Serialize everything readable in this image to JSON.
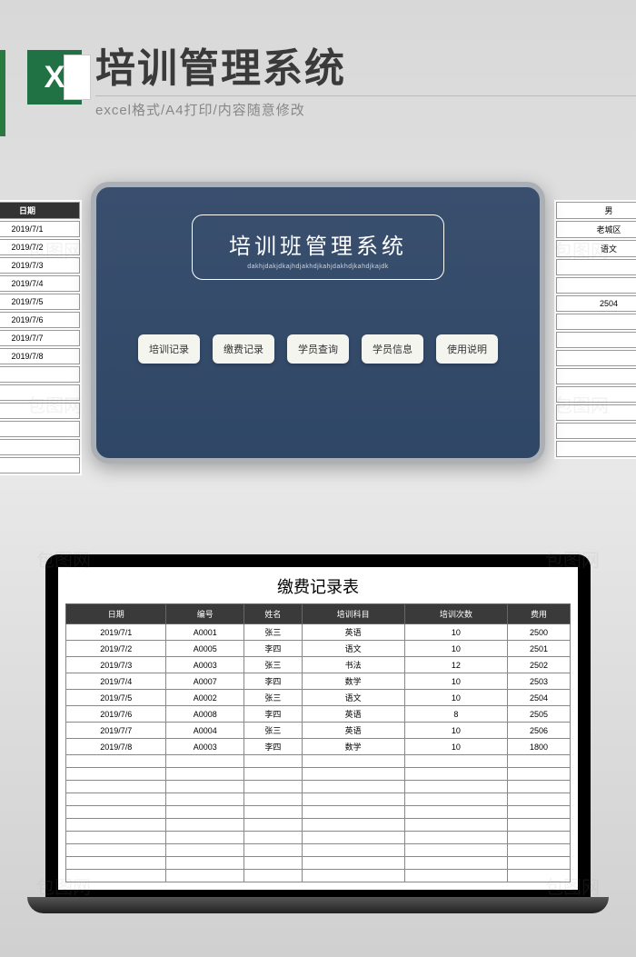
{
  "header": {
    "title": "培训管理系统",
    "subtitle": "excel格式/A4打印/内容随意修改",
    "icon_letter": "X"
  },
  "side_left": {
    "header": "日期",
    "rows": [
      "2019/7/1",
      "2019/7/2",
      "2019/7/3",
      "2019/7/4",
      "2019/7/5",
      "2019/7/6",
      "2019/7/7",
      "2019/7/8"
    ]
  },
  "side_right": {
    "rows": [
      "男",
      "老城区",
      "语文",
      "",
      "",
      "2504",
      ""
    ]
  },
  "panel": {
    "title": "培训班管理系统",
    "subtitle": "dakhjdakjdkajhdjakhdjkahjdakhdjkahdjkajdk",
    "buttons": [
      "培训记录",
      "缴费记录",
      "学员查询",
      "学员信息",
      "使用说明"
    ]
  },
  "watermark": "包图网",
  "chart_data": {
    "type": "table",
    "title": "缴费记录表",
    "columns": [
      "日期",
      "编号",
      "姓名",
      "培训科目",
      "培训次数",
      "费用"
    ],
    "rows": [
      [
        "2019/7/1",
        "A0001",
        "张三",
        "英语",
        "10",
        "2500"
      ],
      [
        "2019/7/2",
        "A0005",
        "李四",
        "语文",
        "10",
        "2501"
      ],
      [
        "2019/7/3",
        "A0003",
        "张三",
        "书法",
        "12",
        "2502"
      ],
      [
        "2019/7/4",
        "A0007",
        "李四",
        "数学",
        "10",
        "2503"
      ],
      [
        "2019/7/5",
        "A0002",
        "张三",
        "语文",
        "10",
        "2504"
      ],
      [
        "2019/7/6",
        "A0008",
        "李四",
        "英语",
        "8",
        "2505"
      ],
      [
        "2019/7/7",
        "A0004",
        "张三",
        "英语",
        "10",
        "2506"
      ],
      [
        "2019/7/8",
        "A0003",
        "李四",
        "数学",
        "10",
        "1800"
      ]
    ],
    "empty_rows": 10
  }
}
